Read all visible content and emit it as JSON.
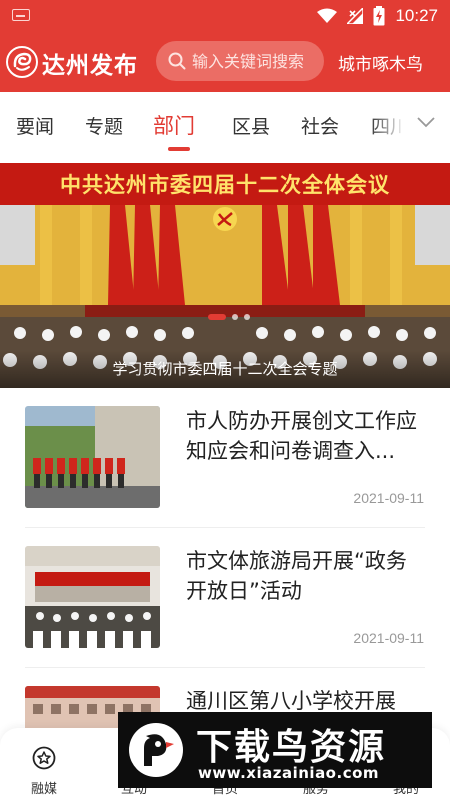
{
  "status_bar": {
    "time": "10:27",
    "icons": [
      "keyboard-icon",
      "wifi-icon",
      "signal-icon",
      "battery-charging-icon"
    ]
  },
  "header": {
    "brand": "达州发布",
    "search_placeholder": "输入关键词搜索",
    "city_link": "城市啄木鸟",
    "accent_color": "#e23c34"
  },
  "tabs": {
    "items": [
      "要闻",
      "专题",
      "部门",
      "区县",
      "社会",
      "四川"
    ],
    "active_index": 2
  },
  "banner": {
    "headline": "中共达州市委四届十二次全体会议",
    "caption": "学习贯彻市委四届十二次全会专题",
    "slide_index": 0,
    "slide_count": 3
  },
  "news": [
    {
      "title": "市人防办开展创文工作应知应会和问卷调查入...",
      "date": "2021-09-11"
    },
    {
      "title": "市文体旅游局开展“政务开放日”活动",
      "date": "2021-09-11"
    },
    {
      "title": "通川区第八小学校开展",
      "date": ""
    }
  ],
  "bottom_nav": {
    "items": [
      {
        "label": "融媒",
        "icon": "star-circle-icon"
      },
      {
        "label": "互动",
        "icon": "chat-icon"
      },
      {
        "label": "首页",
        "icon": "home-icon"
      },
      {
        "label": "服务",
        "icon": "grid-icon"
      },
      {
        "label": "我的",
        "icon": "user-icon"
      }
    ]
  },
  "watermark": {
    "text": "下载鸟资源",
    "url": "www.xiazainiao.com"
  }
}
